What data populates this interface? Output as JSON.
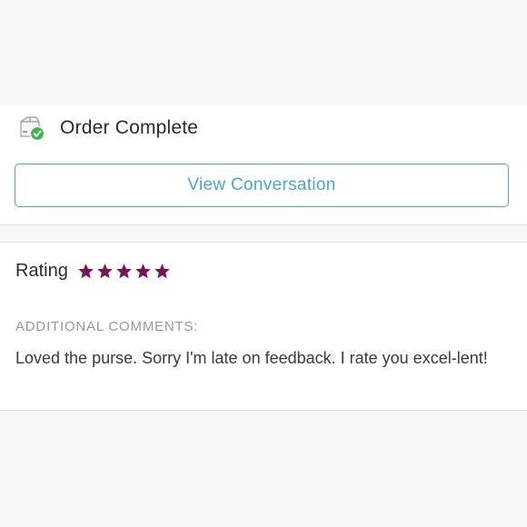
{
  "order": {
    "status_icon": "box-check-icon",
    "status_title": "Order Complete",
    "view_button_label": "View Conversation"
  },
  "rating": {
    "label": "Rating",
    "stars": 5,
    "max_stars": 5,
    "star_icon": "star-icon",
    "star_color": "#7a1259"
  },
  "comments": {
    "heading": "ADDITIONAL COMMENTS:",
    "text": "Loved the purse. Sorry I'm late on feedback. I rate you excel-lent!"
  },
  "colors": {
    "accent": "#4aa6cf",
    "success": "#3cb54a",
    "star": "#7a1259"
  }
}
